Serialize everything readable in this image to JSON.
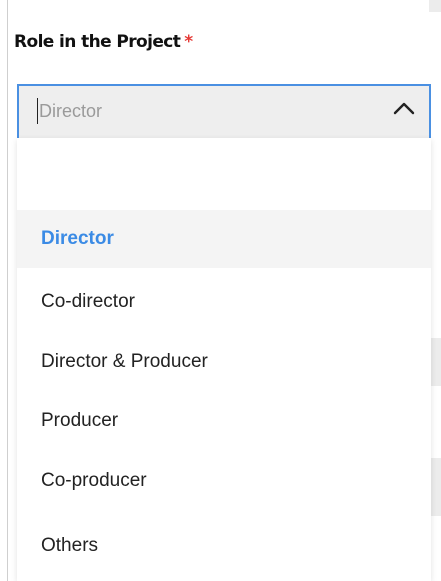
{
  "field": {
    "label": "Role in the Project",
    "required_mark": "*"
  },
  "select": {
    "value": "Director",
    "expanded": true,
    "icon": "chevron-up-icon"
  },
  "options": [
    {
      "label": "Director",
      "selected": true
    },
    {
      "label": "Co-director",
      "selected": false
    },
    {
      "label": "Director & Producer",
      "selected": false
    },
    {
      "label": "Producer",
      "selected": false
    },
    {
      "label": "Co-producer",
      "selected": false
    },
    {
      "label": "Others",
      "selected": false
    }
  ],
  "colors": {
    "accent": "#4a90e2",
    "selected_text": "#3b8be5",
    "required": "#e53935"
  }
}
